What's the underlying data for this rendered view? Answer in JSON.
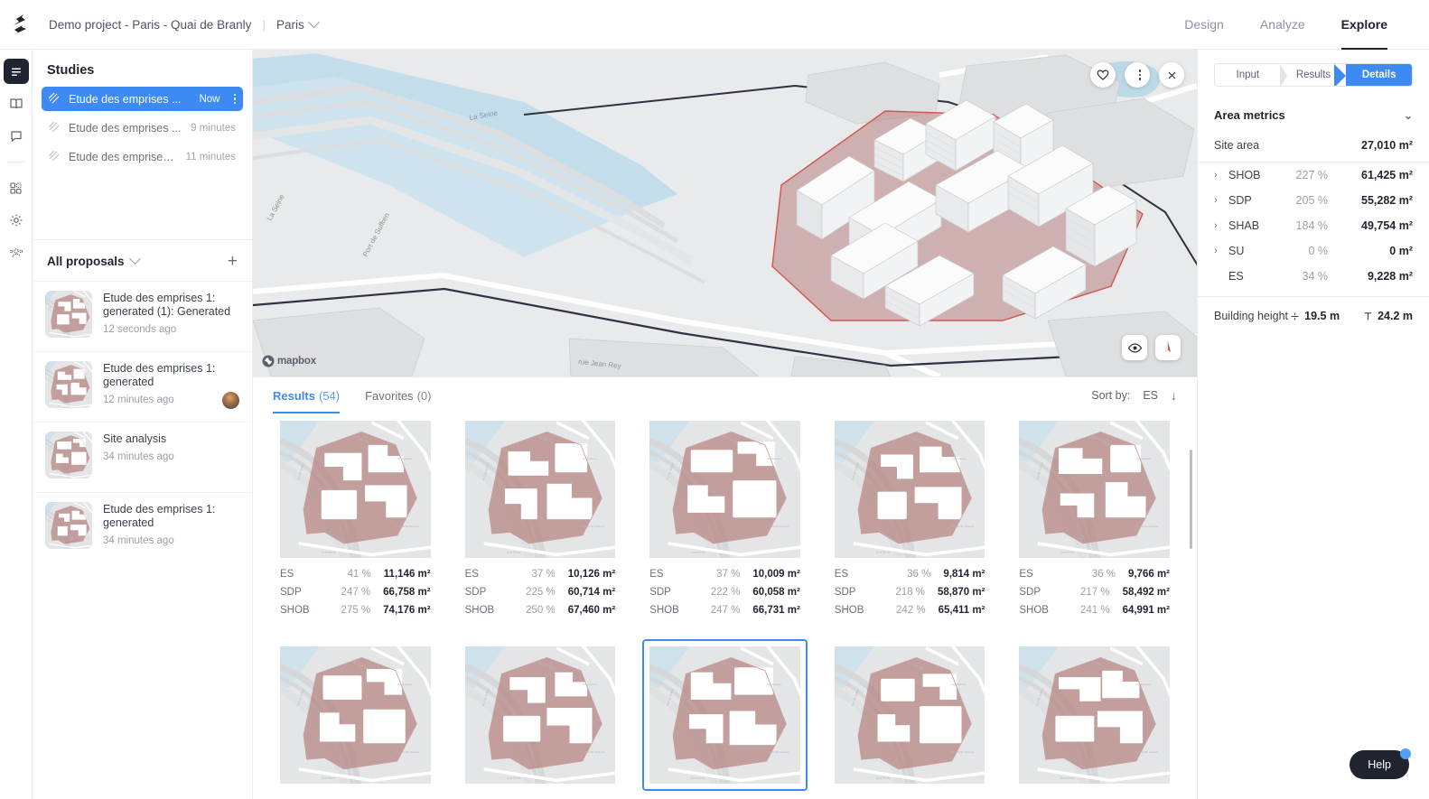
{
  "topbar": {
    "logo_icon": "snaptrude-logo-icon",
    "project_name": "Demo project - Paris - Quai de Branly",
    "separator": "|",
    "city": "Paris",
    "city_chevron_icon": "chevron-down-icon",
    "nav": [
      {
        "label": "Design",
        "active": false
      },
      {
        "label": "Analyze",
        "active": false
      },
      {
        "label": "Explore",
        "active": true
      }
    ]
  },
  "rail": [
    {
      "icon": "hamburger-menu-icon",
      "name": "rail-item-layers",
      "active": true
    },
    {
      "icon": "book-icon",
      "name": "rail-item-library",
      "active": false
    },
    {
      "icon": "comment-icon",
      "name": "rail-item-comments",
      "active": false
    },
    {
      "icon": "divider",
      "name": "rail-divider",
      "active": false
    },
    {
      "icon": "grid-apps-icon",
      "name": "rail-item-apps",
      "active": false
    },
    {
      "icon": "gear-icon",
      "name": "rail-item-settings",
      "active": false
    },
    {
      "icon": "people-icon",
      "name": "rail-item-team",
      "active": false
    }
  ],
  "studies": {
    "title": "Studies",
    "items": [
      {
        "icon": "hatch-icon",
        "name": "Etude des emprises ...",
        "time": "Now",
        "active": true,
        "kebab": true
      },
      {
        "icon": "hatch-icon",
        "name": "Etude des emprises ...",
        "time": "9 minutes",
        "active": false,
        "kebab": false
      },
      {
        "icon": "hatch-icon",
        "name": "Etude des emprises ...",
        "time": "11 minutes",
        "active": false,
        "kebab": false
      }
    ]
  },
  "proposals": {
    "title": "All proposals",
    "chevron_icon": "chevron-down-icon",
    "add_icon": "plus-icon",
    "items": [
      {
        "name": "Etude des emprises 1: generated (1): Generated",
        "time": "12 seconds ago",
        "avatar": false,
        "variant": 1
      },
      {
        "name": "Etude des emprises 1: generated",
        "time": "12 minutes ago",
        "avatar": true,
        "variant": 2
      },
      {
        "name": "Site analysis",
        "time": "34 minutes ago",
        "avatar": false,
        "variant": 3
      },
      {
        "name": "Etude des emprises 1: generated",
        "time": "34 minutes ago",
        "avatar": false,
        "variant": 4
      }
    ]
  },
  "map": {
    "attribution": "mapbox",
    "controls_top": [
      {
        "icon": "heart-icon",
        "name": "favorite-button"
      },
      {
        "icon": "kebab-menu-icon",
        "name": "map-options-button"
      },
      {
        "icon": "close-icon",
        "name": "close-map-button"
      }
    ],
    "controls_bottom": [
      {
        "icon": "eye-icon",
        "name": "visibility-toggle-button"
      },
      {
        "icon": "compass-icon",
        "name": "compass-button"
      }
    ],
    "labels": {
      "river": "La Seine",
      "street_bottom": "rue Jean Rey",
      "street_left": "Port de Suffren"
    }
  },
  "results": {
    "tabs": [
      {
        "label": "Results",
        "count": "(54)",
        "active": true
      },
      {
        "label": "Favorites",
        "count": "(0)",
        "active": false
      }
    ],
    "sort_label": "Sort by:",
    "sort_value": "ES",
    "sort_direction_icon": "arrow-down-icon",
    "metric_keys": [
      "ES",
      "SDP",
      "SHOB"
    ],
    "cards": [
      {
        "selected": false,
        "variant": 1,
        "metrics": [
          {
            "key": "ES",
            "pct": "41 %",
            "val": "11,146 m²"
          },
          {
            "key": "SDP",
            "pct": "247 %",
            "val": "66,758 m²"
          },
          {
            "key": "SHOB",
            "pct": "275 %",
            "val": "74,176 m²"
          }
        ]
      },
      {
        "selected": false,
        "variant": 2,
        "metrics": [
          {
            "key": "ES",
            "pct": "37 %",
            "val": "10,126 m²"
          },
          {
            "key": "SDP",
            "pct": "225 %",
            "val": "60,714 m²"
          },
          {
            "key": "SHOB",
            "pct": "250 %",
            "val": "67,460 m²"
          }
        ]
      },
      {
        "selected": false,
        "variant": 3,
        "metrics": [
          {
            "key": "ES",
            "pct": "37 %",
            "val": "10,009 m²"
          },
          {
            "key": "SDP",
            "pct": "222 %",
            "val": "60,058 m²"
          },
          {
            "key": "SHOB",
            "pct": "247 %",
            "val": "66,731 m²"
          }
        ]
      },
      {
        "selected": false,
        "variant": 4,
        "metrics": [
          {
            "key": "ES",
            "pct": "36 %",
            "val": "9,814 m²"
          },
          {
            "key": "SDP",
            "pct": "218 %",
            "val": "58,870 m²"
          },
          {
            "key": "SHOB",
            "pct": "242 %",
            "val": "65,411 m²"
          }
        ]
      },
      {
        "selected": false,
        "variant": 5,
        "metrics": [
          {
            "key": "ES",
            "pct": "36 %",
            "val": "9,766 m²"
          },
          {
            "key": "SDP",
            "pct": "217 %",
            "val": "58,492 m²"
          },
          {
            "key": "SHOB",
            "pct": "241 %",
            "val": "64,991 m²"
          }
        ]
      }
    ],
    "cards_row2": [
      {
        "selected": false,
        "variant": 6
      },
      {
        "selected": false,
        "variant": 7
      },
      {
        "selected": true,
        "variant": 8
      },
      {
        "selected": false,
        "variant": 9
      },
      {
        "selected": false,
        "variant": 10
      }
    ]
  },
  "rightpanel": {
    "segments": [
      {
        "label": "Input",
        "active": false
      },
      {
        "label": "Results",
        "active": false
      },
      {
        "label": "Details",
        "active": true
      }
    ],
    "section_title": "Area metrics",
    "section_chevron_icon": "chevron-down-icon",
    "site_area": {
      "key": "Site area",
      "val": "27,010 m²"
    },
    "metrics": [
      {
        "key": "SHOB",
        "pct": "227 %",
        "val": "61,425 m²",
        "expandable": true
      },
      {
        "key": "SDP",
        "pct": "205 %",
        "val": "55,282 m²",
        "expandable": true
      },
      {
        "key": "SHAB",
        "pct": "184 %",
        "val": "49,754 m²",
        "expandable": true
      },
      {
        "key": "SU",
        "pct": "0 %",
        "val": "0 m²",
        "expandable": true
      },
      {
        "key": "ES",
        "pct": "34 %",
        "val": "9,228 m²",
        "expandable": false
      }
    ],
    "building_height": {
      "key": "Building height",
      "avg_icon": "average-icon",
      "avg": "19.5 m",
      "max_icon": "max-height-icon",
      "max": "24.2 m"
    }
  },
  "help": {
    "label": "Help",
    "badge_icon": "notification-dot-icon"
  },
  "colors": {
    "accent_blue": "#3d8bf2",
    "dark": "#1f2430",
    "site_rose": "#b08585",
    "text_muted": "#9aa0ab"
  }
}
